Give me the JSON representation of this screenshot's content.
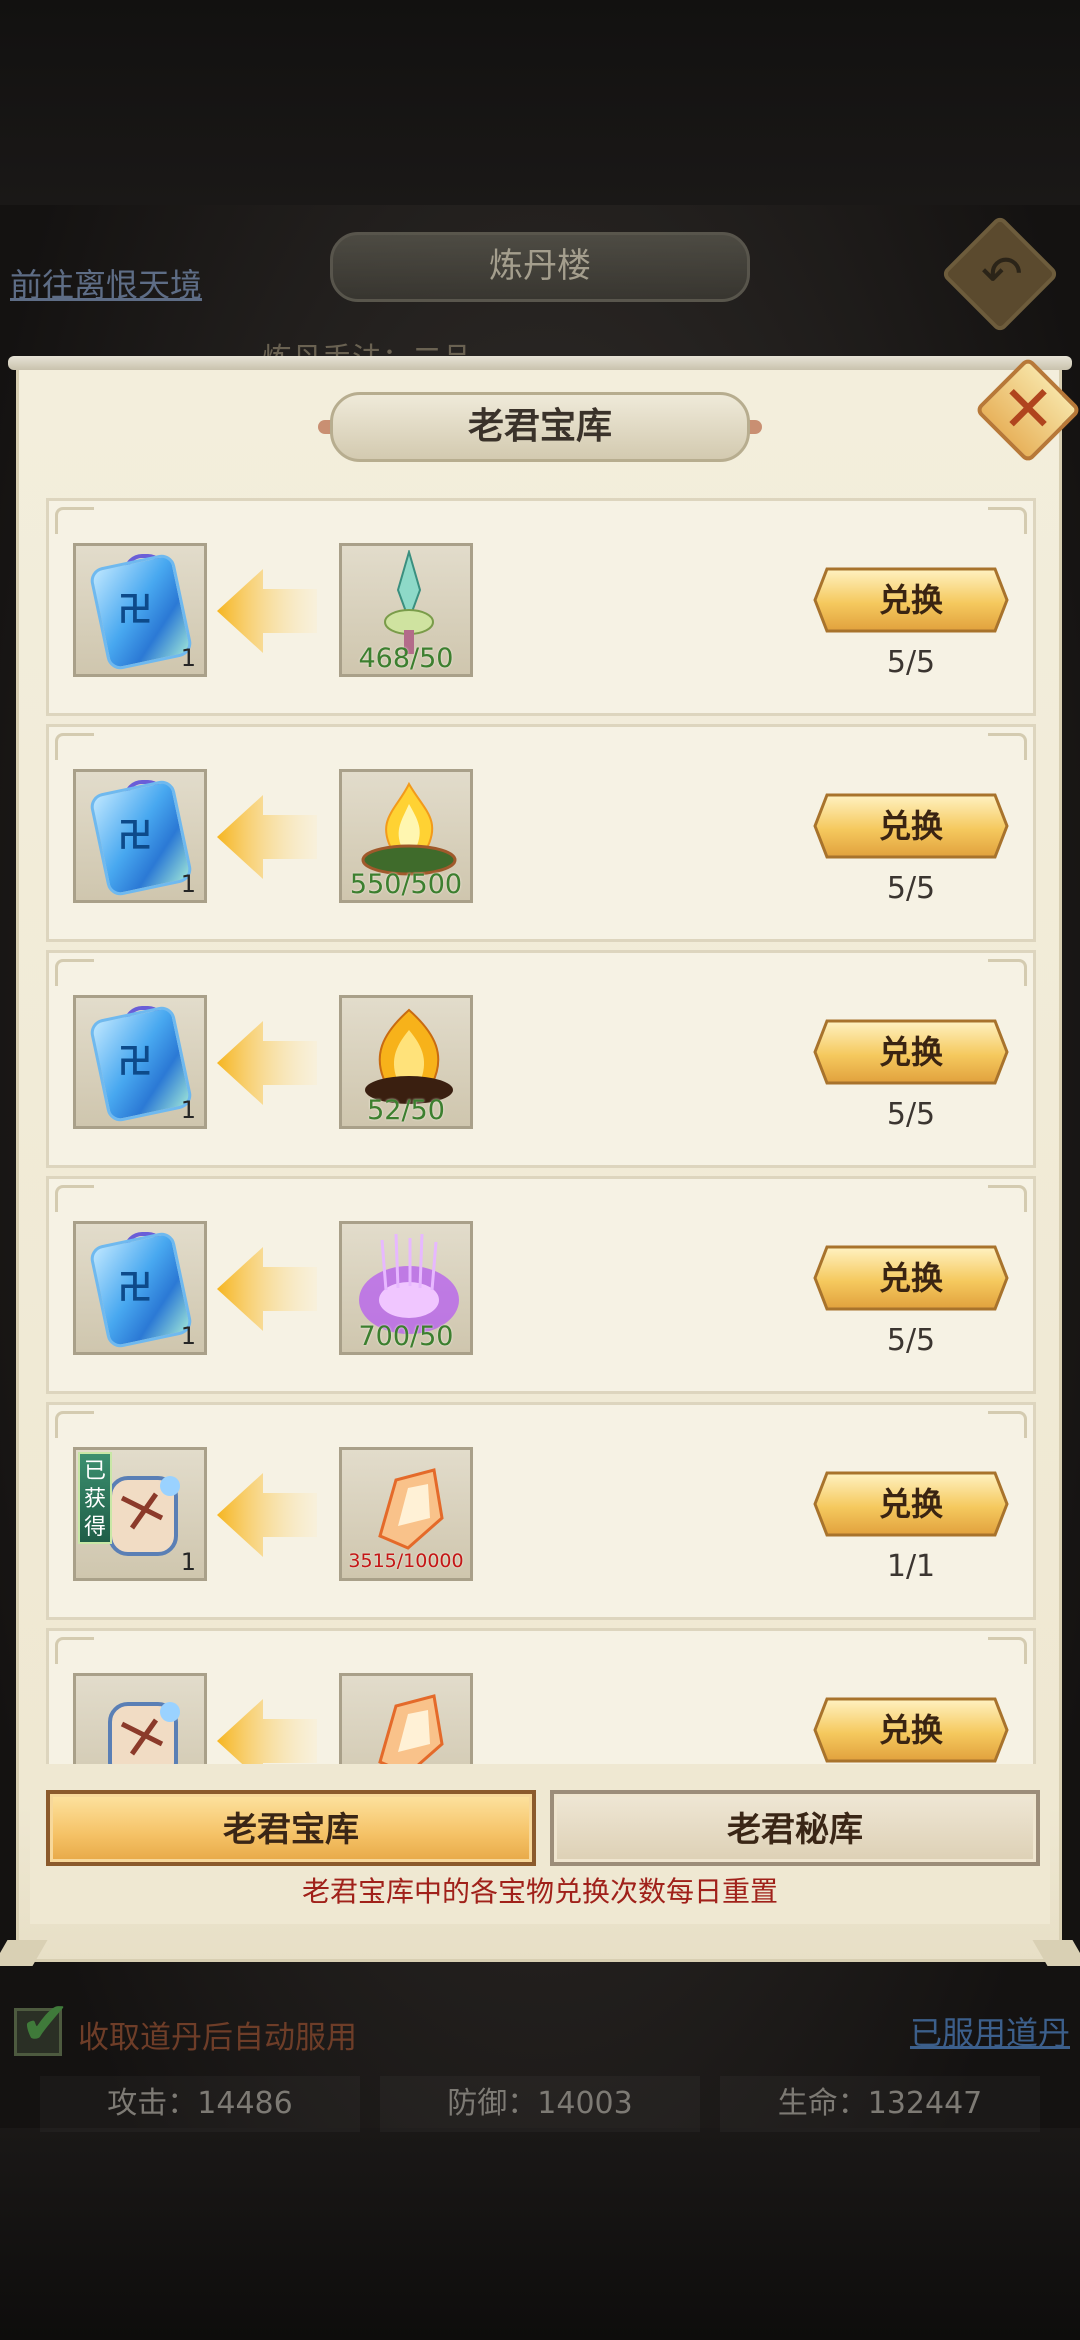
{
  "background": {
    "top_title": "炼丹楼",
    "left_link": "前往离恨天境",
    "subtitle": "炼丹手法：二品",
    "auto_use_label": "收取道丹后自动服用",
    "used_link": "已服用道丹",
    "stats": {
      "attack": "攻击：14486",
      "defense": "防御：14003",
      "hp": "生命：132447"
    }
  },
  "dialog": {
    "title": "老君宝库",
    "exchange_label": "兑换",
    "obtained_badge": "已获得",
    "rows": [
      {
        "reward_qty": "1",
        "reward_icon": "blue-talisman-icon",
        "cost_icon": "jade-sword-icon",
        "cost_progress": "468/50",
        "remaining": "5/5",
        "cost_enough": true
      },
      {
        "reward_qty": "1",
        "reward_icon": "blue-talisman-icon",
        "cost_icon": "flame-cauldron-icon",
        "cost_progress": "550/500",
        "remaining": "5/5",
        "cost_enough": true
      },
      {
        "reward_qty": "1",
        "reward_icon": "blue-talisman-icon",
        "cost_icon": "golden-flame-icon",
        "cost_progress": "52/50",
        "remaining": "5/5",
        "cost_enough": true
      },
      {
        "reward_qty": "1",
        "reward_icon": "blue-talisman-icon",
        "cost_icon": "purple-aura-icon",
        "cost_progress": "700/50",
        "remaining": "5/5",
        "cost_enough": true
      },
      {
        "reward_qty": "1",
        "reward_icon": "scroll-charm-icon",
        "cost_icon": "fire-crystal-icon",
        "cost_progress": "3515/10000",
        "remaining": "1/1",
        "cost_enough": false,
        "obtained": true
      },
      {
        "reward_qty": "",
        "reward_icon": "scroll-charm-icon",
        "cost_icon": "fire-crystal-icon",
        "cost_progress": "",
        "remaining": "",
        "cost_enough": false
      }
    ],
    "tabs": [
      {
        "label": "老君宝库",
        "active": true
      },
      {
        "label": "老君秘库",
        "active": false
      }
    ],
    "hint": "老君宝库中的各宝物兑换次数每日重置"
  }
}
